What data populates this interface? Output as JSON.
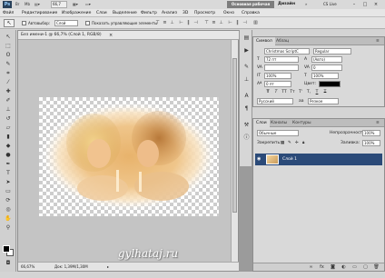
{
  "app": {
    "logo": "Ps",
    "zoom": "66,7",
    "workspace_button": "Основная рабочая среда",
    "design_label": "Дизайн",
    "cs_live": "CS Live"
  },
  "menu": [
    "Файл",
    "Редактирование",
    "Изображение",
    "Слои",
    "Выделение",
    "Фильтр",
    "Анализ",
    "3D",
    "Просмотр",
    "Окно",
    "Справка"
  ],
  "options": {
    "auto_select_label": "Автовыбор:",
    "auto_select_value": "Слой",
    "show_controls_label": "Показать управляющие элементы"
  },
  "document": {
    "tab_title": "Без имени-1 @ 66,7% (Слой 1, RGB/8)",
    "zoom_status": "66,67%",
    "doc_status": "Док: 1,39М/1,30М"
  },
  "character_panel": {
    "tabs": [
      "Символ",
      "Абзац"
    ],
    "font_family": "Christmas ScriptC",
    "font_style": "Regular",
    "size": "72 пт",
    "leading": "(Авто)",
    "kerning": "",
    "tracking": "0",
    "vscale": "100%",
    "hscale": "100%",
    "baseline": "0 пт",
    "color_label": "Цвет:",
    "color": "#000000",
    "format_buttons": [
      "T",
      "T",
      "TT",
      "Tт",
      "T'",
      "T,",
      "T",
      "T"
    ],
    "language": "Русский",
    "antialias_prefix": "аа",
    "antialias": "Резкое"
  },
  "layers_panel": {
    "tabs": [
      "Слои",
      "Каналы",
      "Контуры"
    ],
    "blend_mode": "Обычные",
    "opacity_label": "Непрозрачность:",
    "opacity": "100%",
    "lock_label": "Закрепить:",
    "fill_label": "Заливка:",
    "fill": "100%",
    "layer_name": "Слой 1"
  },
  "watermark": "gylhataj.ru"
}
